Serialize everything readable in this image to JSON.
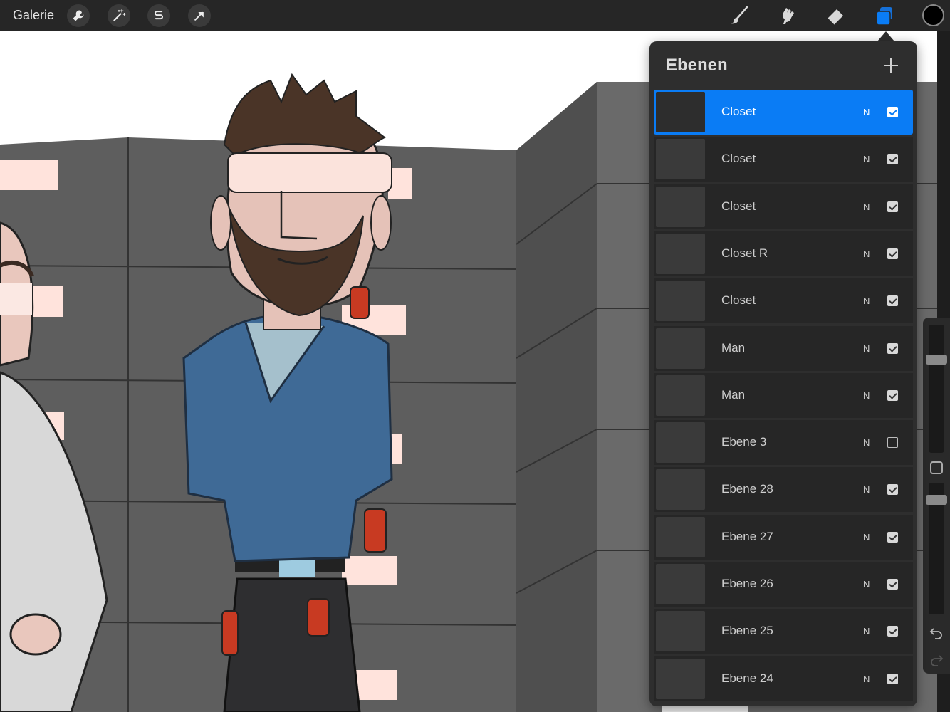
{
  "toolbar": {
    "gallery_label": "Galerie",
    "left_tools": [
      {
        "icon": "wrench-icon"
      },
      {
        "icon": "magic-wand-icon"
      },
      {
        "icon": "selection-icon"
      },
      {
        "icon": "transform-arrow-icon"
      }
    ],
    "right_tools": [
      {
        "icon": "brush-icon"
      },
      {
        "icon": "smudge-icon"
      },
      {
        "icon": "eraser-icon"
      },
      {
        "icon": "layers-icon",
        "active": true
      }
    ],
    "current_color": "#000000",
    "accent_color": "#0a7cf5"
  },
  "layers_panel": {
    "title": "Ebenen",
    "add_icon": "plus-icon",
    "layers": [
      {
        "name": "Closet",
        "blend": "N",
        "visible": true,
        "active": true
      },
      {
        "name": "Closet",
        "blend": "N",
        "visible": true
      },
      {
        "name": "Closet",
        "blend": "N",
        "visible": true
      },
      {
        "name": "Closet R",
        "blend": "N",
        "visible": true
      },
      {
        "name": "Closet",
        "blend": "N",
        "visible": true
      },
      {
        "name": "Man",
        "blend": "N",
        "visible": true
      },
      {
        "name": "Man",
        "blend": "N",
        "visible": true
      },
      {
        "name": "Ebene 3",
        "blend": "N",
        "visible": false
      },
      {
        "name": "Ebene 28",
        "blend": "N",
        "visible": true
      },
      {
        "name": "Ebene 27",
        "blend": "N",
        "visible": true
      },
      {
        "name": "Ebene 26",
        "blend": "N",
        "visible": true
      },
      {
        "name": "Ebene 25",
        "blend": "N",
        "visible": true
      },
      {
        "name": "Ebene 24",
        "blend": "N",
        "visible": true
      }
    ]
  },
  "sidebar": {
    "brush_size_level": 0.75,
    "opacity_level": 0.9,
    "undo_icon": "undo-icon",
    "redo_icon": "redo-icon"
  }
}
